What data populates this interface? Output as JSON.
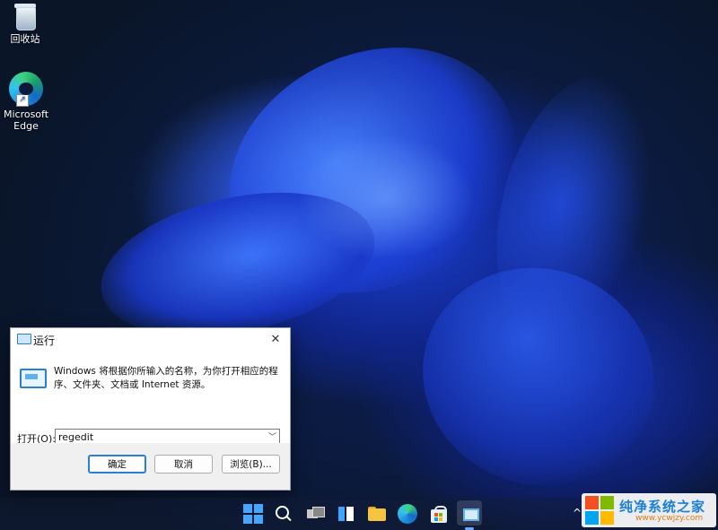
{
  "desktop": {
    "icons": [
      {
        "label": "回收站"
      },
      {
        "label_line1": "Microsoft",
        "label_line2": "Edge"
      }
    ]
  },
  "run_dialog": {
    "title": "运行",
    "close_glyph": "✕",
    "description": "Windows 将根据你所输入的名称，为你打开相应的程序、文件夹、文档或 Internet 资源。",
    "open_label": "打开(O):",
    "open_value": "regedit",
    "buttons": {
      "ok": "确定",
      "cancel": "取消",
      "browse": "浏览(B)..."
    }
  },
  "taskbar": {
    "items": [
      "start",
      "search",
      "task-view",
      "widgets",
      "file-explorer",
      "edge",
      "store",
      "run"
    ],
    "overflow_glyph": "^"
  },
  "watermark": {
    "title": "纯净系统之家",
    "url": "www.ycwjzy.com"
  },
  "colors": {
    "accent": "#2a7fd4",
    "wallpaper": "#1b3fd0"
  }
}
